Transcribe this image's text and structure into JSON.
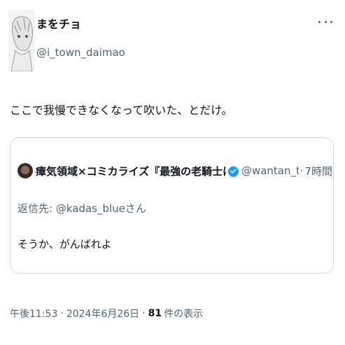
{
  "author": {
    "display_name": "まをチョ",
    "handle": "@i_town_daimao"
  },
  "tweet": {
    "text": "ここで我慢できなくなって吹いた、とだけ。"
  },
  "quote": {
    "display_name": "瘴気領域×コミカライズ『最強の老騎士は迷宮で屋台を",
    "handle": "@wantan_tabe",
    "separator": "·",
    "time": "7時間",
    "reply_prefix": "返信先: ",
    "reply_mention": "@kadas_blue",
    "reply_suffix": "さん",
    "text": "そうか、がんばれよ",
    "verified_color": "#1d9bf0"
  },
  "meta": {
    "time": "午後11:53",
    "dot": "·",
    "date": "2024年6月26日",
    "views_count": "81",
    "views_label": "件の表示"
  }
}
